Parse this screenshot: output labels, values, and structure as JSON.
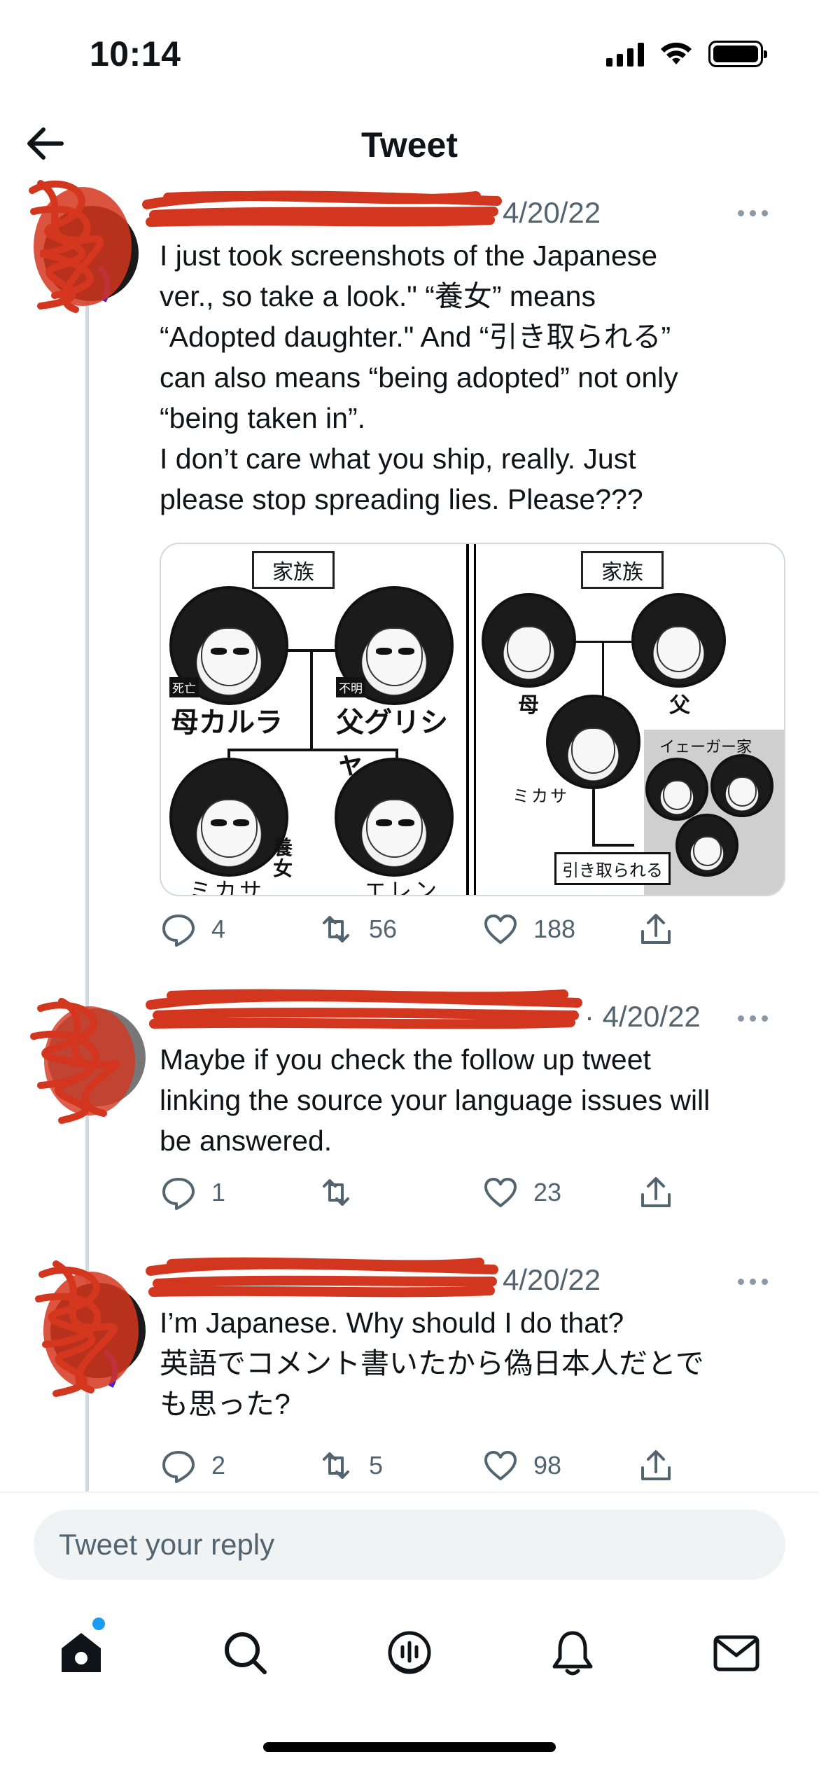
{
  "status_bar": {
    "time": "10:14"
  },
  "header": {
    "title": "Tweet",
    "back_icon": "back-arrow-icon"
  },
  "tweets": [
    {
      "date": "4/20/22",
      "text": "I just took screenshots of the Japanese\nver., so take a look.\" “養女” means\n“Adopted daughter.\" And “引き取られる”\ncan also means “being adopted” not only\n“being taken in”.\nI don’t care what you ship, really. Just\nplease stop spreading lies. Please???",
      "replies": "4",
      "retweets": "56",
      "likes": "188",
      "media": {
        "left": {
          "family_label": "家族",
          "mother_tag": "死亡",
          "mother_name": "母カルラ",
          "father_tag": "不明",
          "father_name": "父グリシャ",
          "child1_name": "ミカサ",
          "child1_note": "養女",
          "child2_name": "エレン"
        },
        "right": {
          "family_label": "家族",
          "mother_name": "母",
          "father_name": "父",
          "child_name": "ミカサ",
          "other_family": "イェーガー家",
          "adopted_label": "引き取られる"
        }
      }
    },
    {
      "date": "· 4/20/22",
      "text": "Maybe if you check the follow up tweet\nlinking the source your language issues will\nbe answered.",
      "replies": "1",
      "retweets": "",
      "likes": "23"
    },
    {
      "date": "4/20/22",
      "text": "I’m Japanese. Why should I do that?\n英語でコメント書いたから偽日本人だとで\nも思った?",
      "replies": "2",
      "retweets": "5",
      "likes": "98"
    }
  ],
  "reply_box": {
    "placeholder": "Tweet your reply"
  },
  "tabs": [
    "home-icon",
    "search-icon",
    "spaces-icon",
    "notifications-icon",
    "messages-icon"
  ],
  "colors": {
    "redaction": "#d3361f",
    "accent": "#1d9bf0",
    "muted": "#536471"
  }
}
